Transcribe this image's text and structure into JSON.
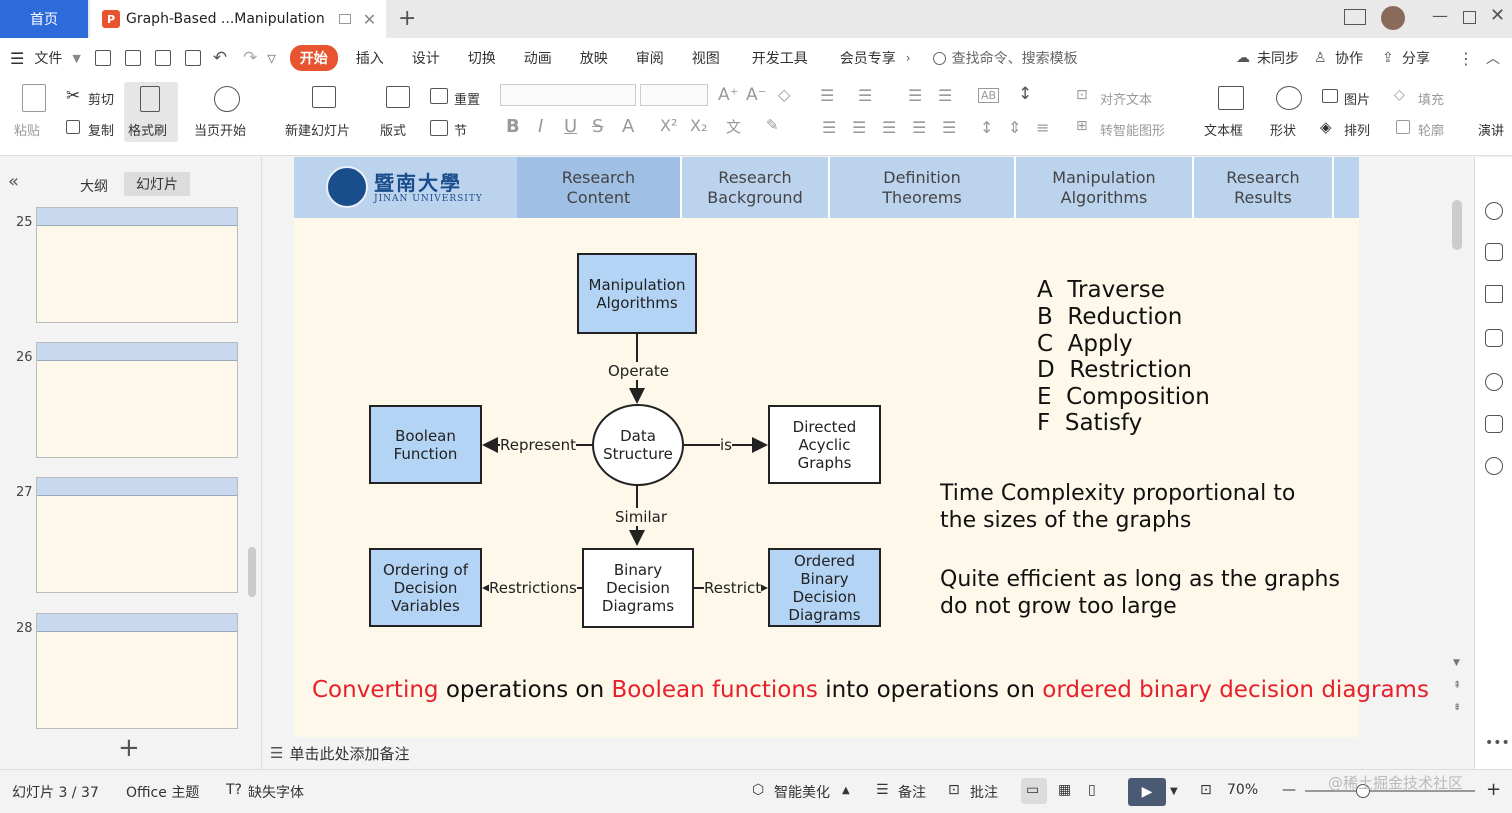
{
  "titlebar": {
    "home_tab": "首页",
    "doc_tab": "Graph-Based ...Manipulation",
    "ppt_badge": "P"
  },
  "menu": {
    "file": "文件",
    "items": [
      "开始",
      "插入",
      "设计",
      "切换",
      "动画",
      "放映",
      "审阅",
      "视图",
      "开发工具",
      "会员专享"
    ],
    "search": "查找命令、搜索模板",
    "sync": "未同步",
    "collab": "协作",
    "share": "分享"
  },
  "ribbon": {
    "paste": "粘贴",
    "cut": "剪切",
    "copy": "复制",
    "format_painter": "格式刷",
    "from_current": "当页开始",
    "new_slide": "新建幻灯片",
    "layout": "版式",
    "reset": "重置",
    "section": "节",
    "align_text": "对齐文本",
    "smart_shape": "转智能图形",
    "textbox": "文本框",
    "shape": "形状",
    "picture": "图片",
    "arrange": "排列",
    "fill": "填充",
    "outline": "轮廓",
    "presenter": "演讲"
  },
  "leftpanel": {
    "outline_tab": "大纲",
    "slides_tab": "幻灯片",
    "thumbs": [
      "25",
      "26",
      "27",
      "28"
    ]
  },
  "slide": {
    "logo_cn": "暨南大學",
    "logo_en": "JINAN UNIVERSITY",
    "nav": [
      "Research\nContent",
      "Research\nBackground",
      "Definition\nTheorems",
      "Manipulation\nAlgorithms",
      "Research\nResults"
    ],
    "diagram": {
      "manip": "Manipulation\nAlgorithms",
      "operate": "Operate",
      "data": "Data\nStructure",
      "represent": "Represent",
      "is": "is",
      "bool": "Boolean\nFunction",
      "dag": "Directed\nAcyclic\nGraphs",
      "similar": "Similar",
      "bdd": "Binary\nDecision\nDiagrams",
      "restrictions": "Restrictions",
      "restrict": "Restrict",
      "order": "Ordering of\nDecision\nVariables",
      "obdd": "Ordered\nBinary\nDecision\nDiagrams"
    },
    "list": [
      "A  Traverse",
      "B  Reduction",
      "C  Apply",
      "D  Restriction",
      "E  Composition",
      "F  Satisfy"
    ],
    "para1": "Time Complexity proportional to\nthe sizes of the graphs",
    "para2": "Quite efficient as long as the graphs\ndo not grow too large",
    "bottom": [
      "Converting",
      " operations on ",
      "Boolean functions",
      " into operations on ",
      "ordered binary decision diagrams"
    ],
    "red": "#e8202a"
  },
  "notes": "单击此处添加备注",
  "status": {
    "slide": "幻灯片 3 / 37",
    "theme": "Office 主题",
    "missing_font": "缺失字体",
    "beautify": "智能美化",
    "notes": "备注",
    "comments": "批注",
    "zoom": "70%",
    "watermark": "@稀土掘金技术社区"
  },
  "colors": {
    "accent": "#2d6bdb",
    "start": "#e8542f",
    "box_blue": "#b4d4f6",
    "slide_bg": "#fdf8ea"
  }
}
